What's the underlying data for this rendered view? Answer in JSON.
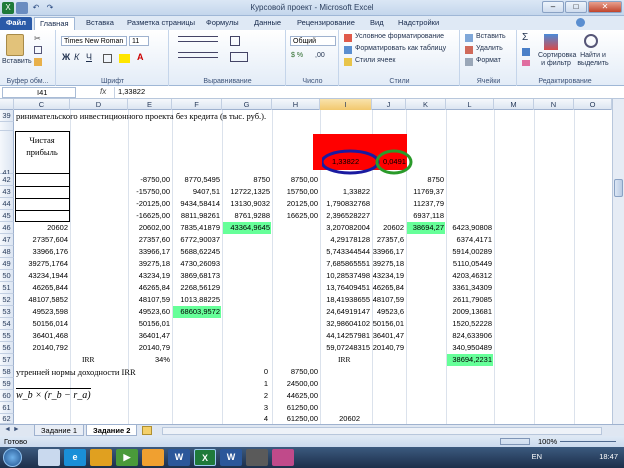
{
  "window": {
    "title": "Курсовой проект - Microsoft Excel"
  },
  "tabs": [
    "Файл",
    "Главная",
    "Вставка",
    "Разметка страницы",
    "Формулы",
    "Данные",
    "Рецензирование",
    "Вид",
    "Надстройки"
  ],
  "ribbon": {
    "clipboard": {
      "paste": "Вставить",
      "label": "Буфер обм..."
    },
    "font": {
      "name": "Times New Roman",
      "size": "11",
      "label": "Шрифт"
    },
    "alignment": {
      "label": "Выравнивание"
    },
    "number": {
      "format": "Общий",
      "label": "Число"
    },
    "styles": {
      "cond": "Условное форматирование",
      "table": "Форматировать как таблицу",
      "cell": "Стили ячеек",
      "label": "Стили"
    },
    "cells": {
      "insert": "Вставить",
      "delete": "Удалить",
      "format": "Формат",
      "label": "Ячейки"
    },
    "editing": {
      "sort": "Сортировка и фильтр",
      "find": "Найти и выделить",
      "label": "Редактирование"
    }
  },
  "formula_bar": {
    "name_box": "I41",
    "fx": "fx",
    "value": "1,33822"
  },
  "columns": [
    "C",
    "D",
    "E",
    "F",
    "G",
    "H",
    "I",
    "J",
    "K",
    "L",
    "M",
    "N",
    "O"
  ],
  "rows": {
    "r39": {
      "num": "39",
      "text": "ринимательского инвестиционного проекта без кредита (в тыс. руб.)."
    },
    "r41": {
      "num": "41",
      "label1": "Чистая",
      "label2": "прибыль",
      "i": "1,33822",
      "j": "0,0491"
    },
    "r42": {
      "num": "42",
      "e": "-8750,00",
      "f": "8770,5495",
      "g": "8750",
      "h": "8750,00",
      "k": "8750"
    },
    "r43": {
      "num": "43",
      "e": "-15750,00",
      "f": "9407,51",
      "g": "12722,1325",
      "h": "15750,00",
      "i": "1,33822",
      "k": "11769,37"
    },
    "r44": {
      "num": "44",
      "e": "-20125,00",
      "f": "9434,58414",
      "g": "13130,9032",
      "h": "20125,00",
      "i": "1,790832768",
      "k": "11237,79"
    },
    "r45": {
      "num": "45",
      "e": "-16625,00",
      "f": "8811,98261",
      "g": "8761,9288",
      "h": "16625,00",
      "i": "2,396528227",
      "k": "6937,118"
    },
    "r46": {
      "num": "46",
      "c": "20602",
      "e": "20602,00",
      "f": "7835,41879",
      "g": "43364,9645",
      "i": "3,207082004",
      "j": "20602",
      "k": "38694,27",
      "l": "6423,90808"
    },
    "r47": {
      "num": "47",
      "c": "27357,604",
      "e": "27357,60",
      "f": "6772,90037",
      "i": "4,29178128",
      "j": "27357,6",
      "l": "6374,4171"
    },
    "r48": {
      "num": "48",
      "c": "33966,176",
      "e": "33966,17",
      "f": "5688,62245",
      "i": "5,743344544",
      "j": "33966,17",
      "l": "5914,00289"
    },
    "r49": {
      "num": "49",
      "c": "39275,1764",
      "e": "39275,18",
      "f": "4730,26093",
      "i": "7,685865551",
      "j": "39275,18",
      "l": "5110,05449"
    },
    "r50": {
      "num": "50",
      "c": "43234,1944",
      "e": "43234,19",
      "f": "3869,68173",
      "i": "10,28537498",
      "j": "43234,19",
      "l": "4203,46312"
    },
    "r51": {
      "num": "51",
      "c": "46265,844",
      "e": "46265,84",
      "f": "2268,56129",
      "i": "13,76409451",
      "j": "46265,84",
      "l": "3361,34309"
    },
    "r52": {
      "num": "52",
      "c": "48107,5852",
      "e": "48107,59",
      "f": "1013,88225",
      "i": "18,41938655",
      "j": "48107,59",
      "l": "2611,79085"
    },
    "r53": {
      "num": "53",
      "c": "49523,598",
      "e": "49523,60",
      "f": "68603,9572",
      "i": "24,64919147",
      "j": "49523,6",
      "l": "2009,13681"
    },
    "r54": {
      "num": "54",
      "c": "50156,014",
      "e": "50156,01",
      "i": "32,98604102",
      "j": "50156,01",
      "l": "1520,52228"
    },
    "r55": {
      "num": "55",
      "c": "36401,468",
      "e": "36401,47",
      "i": "44,14257981",
      "j": "36401,47",
      "l": "824,633906"
    },
    "r56": {
      "num": "56",
      "c": "20140,792",
      "e": "20140,79",
      "i": "59,07248315",
      "j": "20140,79",
      "l": "340,950489"
    },
    "r57": {
      "num": "57",
      "d": "IRR",
      "e": "34%",
      "i": "IRR",
      "l": "38694,2231"
    },
    "r58": {
      "num": "58",
      "text": "утренней нормы доходности IRR",
      "g": "0",
      "h": "8750,00"
    },
    "r59": {
      "num": "59",
      "g": "1",
      "h": "24500,00"
    },
    "r60": {
      "num": "60",
      "formula": "w_b × (r_b − r_a)",
      "g": "2",
      "h": "44625,00"
    },
    "r61": {
      "num": "61",
      "g": "3",
      "h": "61250,00"
    },
    "r62": {
      "num": "62",
      "g": "4",
      "h": "61250,00",
      "i": "20602"
    }
  },
  "sheets": [
    "Задание 1",
    "Задание 2"
  ],
  "status": {
    "ready": "Готово",
    "zoom": "100%"
  },
  "taskbar": {
    "lang": "EN",
    "time": "18:47"
  },
  "colors": {
    "highlight_red": "#ff0000",
    "highlight_green": "#66ff99",
    "circle_blue": "#1a1aa0",
    "circle_green": "#2a9a2a"
  }
}
